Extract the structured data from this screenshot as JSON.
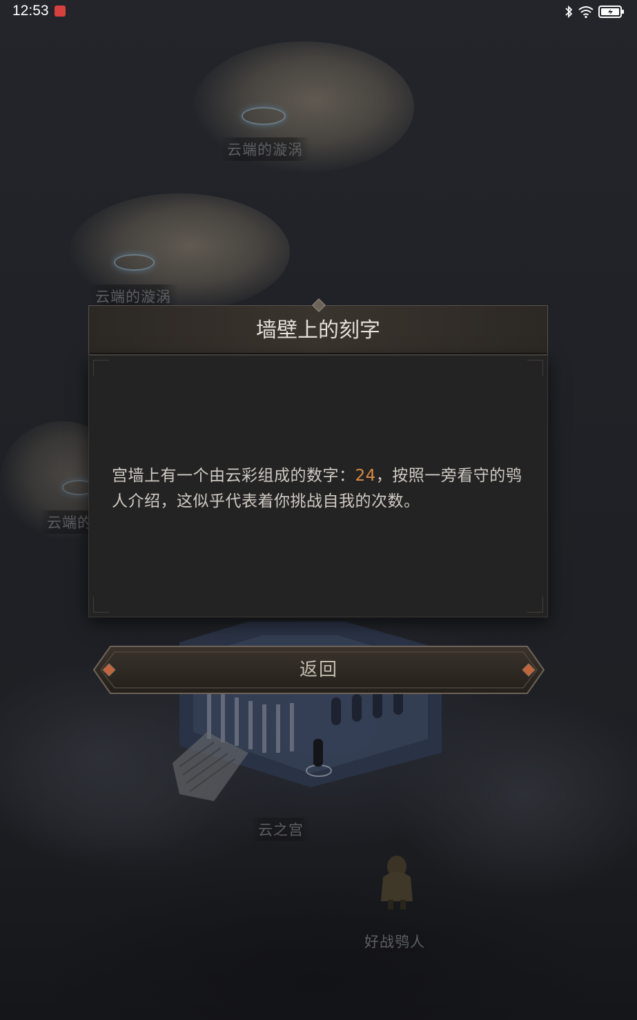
{
  "status_bar": {
    "time": "12:53",
    "icons": [
      "notification-icon",
      "bluetooth-icon",
      "wifi-icon",
      "battery-icon"
    ]
  },
  "map": {
    "locations": [
      {
        "name": "云端的漩涡"
      },
      {
        "name": "云端的漩涡"
      },
      {
        "name": "云端的"
      },
      {
        "name": "云之宫"
      },
      {
        "name": "好战鸮人"
      }
    ]
  },
  "dialog": {
    "title": "墙壁上的刻字",
    "message_before": "宫墙上有一个由云彩组成的数字：",
    "highlight_number": "24",
    "message_after": "，按照一旁看守的鸮人介绍，这似乎代表着你挑战自我的次数。",
    "highlight_color": "#d98d42"
  },
  "buttons": {
    "back_label": "返回"
  }
}
